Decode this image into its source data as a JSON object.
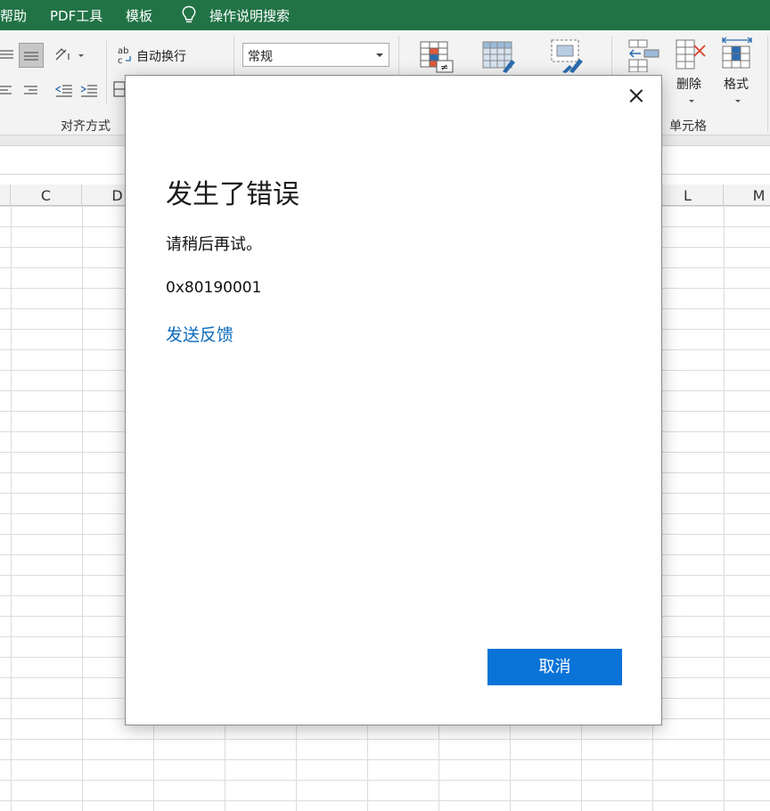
{
  "menubar": {
    "items": [
      "帮助",
      "PDF工具",
      "模板",
      "操作说明搜索"
    ],
    "search_icon": "lightbulb-icon",
    "bg_color": "#217346"
  },
  "ribbon": {
    "wrap_text_label": "自动换行",
    "number_format_value": "常规",
    "delete_label": "删除",
    "format_label": "格式",
    "groups": {
      "alignment": "对齐方式",
      "cells": "单元格"
    }
  },
  "columns": [
    "C",
    "D",
    "L",
    "M"
  ],
  "dialog": {
    "title": "发生了错误",
    "message": "请稍后再试。",
    "error_code": "0x80190001",
    "feedback_link": "发送反馈",
    "cancel_button": "取消",
    "button_color": "#0a73d8",
    "link_color": "#0f6cbd"
  }
}
